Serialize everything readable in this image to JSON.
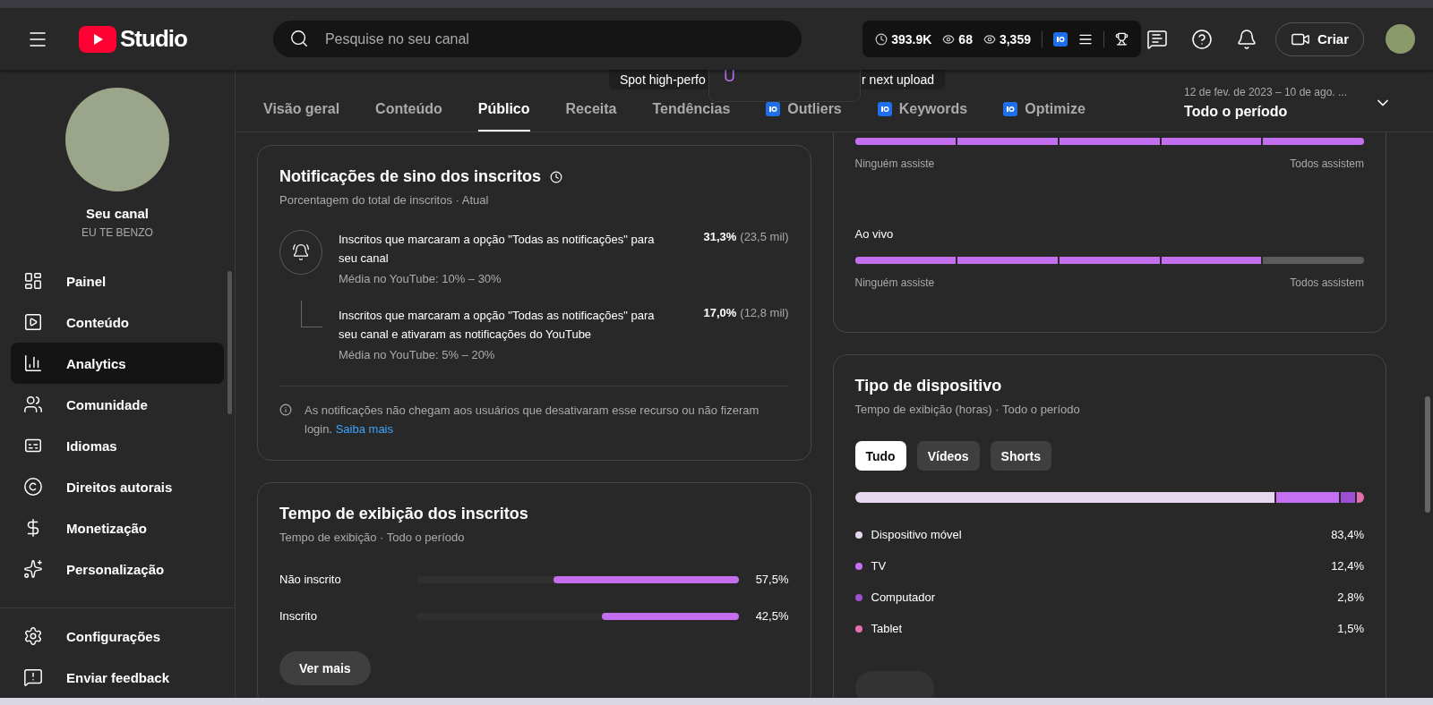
{
  "header": {
    "brand": "Studio",
    "search": {
      "placeholder": "Pesquise no seu canal"
    },
    "stats": [
      {
        "kind": "clock",
        "value": "393.9K"
      },
      {
        "kind": "eye",
        "value": "68"
      },
      {
        "kind": "eye",
        "value": "3,359"
      }
    ],
    "create_button": "Criar"
  },
  "overlay": {
    "left_text": "Spot high-perfo",
    "right_text": "r next upload",
    "popup_letter": "U"
  },
  "sidebar": {
    "channel_label": "Seu canal",
    "channel_name": "EU TE BENZO",
    "items": [
      {
        "kind": "dashboard",
        "label": "Painel",
        "selected": false
      },
      {
        "kind": "content",
        "label": "Conteúdo",
        "selected": false
      },
      {
        "kind": "analytics",
        "label": "Analytics",
        "selected": true
      },
      {
        "kind": "community",
        "label": "Comunidade",
        "selected": false
      },
      {
        "kind": "subtitles",
        "label": "Idiomas",
        "selected": false
      },
      {
        "kind": "copyright",
        "label": "Direitos autorais",
        "selected": false
      },
      {
        "kind": "money",
        "label": "Monetização",
        "selected": false
      },
      {
        "kind": "customize",
        "label": "Personalização",
        "selected": false
      }
    ],
    "footer_items": [
      {
        "kind": "settings",
        "label": "Configurações"
      },
      {
        "kind": "feedback",
        "label": "Enviar feedback"
      }
    ]
  },
  "tabs": [
    {
      "label": "Visão geral",
      "selected": false,
      "plugin": false
    },
    {
      "label": "Conteúdo",
      "selected": false,
      "plugin": false
    },
    {
      "label": "Público",
      "selected": true,
      "plugin": false
    },
    {
      "label": "Receita",
      "selected": false,
      "plugin": false
    },
    {
      "label": "Tendências",
      "selected": false,
      "plugin": false
    },
    {
      "label": "Outliers",
      "selected": false,
      "plugin": true
    },
    {
      "label": "Keywords",
      "selected": false,
      "plugin": true
    },
    {
      "label": "Optimize",
      "selected": false,
      "plugin": true
    }
  ],
  "date_range": {
    "range": "12 de fev. de 2023 – 10 de ago. ...",
    "period": "Todo o período"
  },
  "bell_card": {
    "title": "Notificações de sino dos inscritos",
    "subtitle": "Porcentagem do total de inscritos · Atual",
    "rows": [
      {
        "kind": "bell",
        "text": "Inscritos que marcaram a opção \"Todas as notificações\" para seu canal",
        "average": "Média no YouTube: 10% – 30%",
        "percent": "31,3%",
        "count": "(23,5 mil)"
      },
      {
        "kind": "branch",
        "text": "Inscritos que marcaram a opção \"Todas as notificações\" para seu canal e ativaram as notificações do YouTube",
        "average": "Média no YouTube: 5% – 20%",
        "percent": "17,0%",
        "count": "(12,8 mil)"
      }
    ],
    "note": "As notificações não chegam aos usuários que desativaram esse recurso ou não fizeram login.",
    "link": "Saiba mais"
  },
  "watch_card": {
    "title": "Tempo de exibição dos inscritos",
    "subtitle": "Tempo de exibição · Todo o período",
    "rows": [
      {
        "label": "Não inscrito",
        "level": 0.575,
        "value": "57,5%"
      },
      {
        "label": "Inscrito",
        "level": 0.425,
        "value": "42,5%"
      }
    ],
    "button": "Ver mais"
  },
  "retention_card": {
    "rows": [
      {
        "level": 1,
        "left": "Ninguém assiste",
        "right": "Todos assistem"
      },
      {
        "label": "Ao vivo",
        "level": 0.8,
        "left": "Ninguém assiste",
        "right": "Todos assistem"
      }
    ]
  },
  "device_card": {
    "title": "Tipo de dispositivo",
    "subtitle": "Tempo de exibição (horas) · Todo o período",
    "filters": [
      {
        "label": "Tudo",
        "selected": true
      },
      {
        "label": "Vídeos",
        "selected": false
      },
      {
        "label": "Shorts",
        "selected": false
      }
    ],
    "devices": [
      {
        "label": "Dispositivo móvel",
        "value": "83,4%",
        "color": "#e8d7f1"
      },
      {
        "label": "TV",
        "value": "12,4%",
        "color": "#c56ff2"
      },
      {
        "label": "Computador",
        "value": "2,8%",
        "color": "#9b4fd1"
      },
      {
        "label": "Tablet",
        "value": "1,5%",
        "color": "#e36fae"
      }
    ]
  }
}
